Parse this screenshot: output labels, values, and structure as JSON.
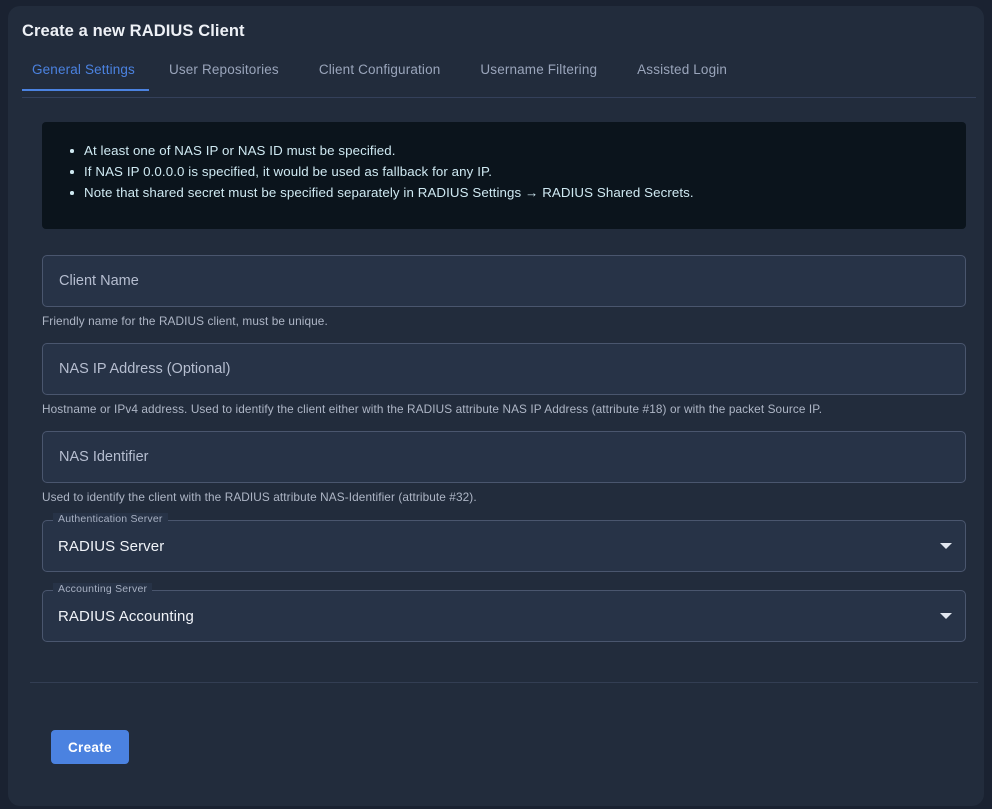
{
  "header": {
    "title": "Create a new RADIUS Client"
  },
  "tabs": {
    "active_index": 0,
    "items": [
      {
        "label": "General Settings"
      },
      {
        "label": "User Repositories"
      },
      {
        "label": "Client Configuration"
      },
      {
        "label": "Username Filtering"
      },
      {
        "label": "Assisted Login"
      }
    ]
  },
  "info_banner": {
    "bullets": [
      "At least one of NAS IP or NAS ID must be specified.",
      "If NAS IP 0.0.0.0 is specified, it would be used as fallback for any IP.",
      "Note that shared secret must be specified separately in RADIUS Settings → RADIUS Shared Secrets."
    ]
  },
  "form": {
    "client_name": {
      "placeholder": "Client Name",
      "value": "",
      "helper": "Friendly name for the RADIUS client, must be unique."
    },
    "nas_ip": {
      "placeholder": "NAS IP Address (Optional)",
      "value": "",
      "helper": "Hostname or IPv4 address. Used to identify the client either with the RADIUS attribute NAS IP Address (attribute #18) or with the packet Source IP."
    },
    "nas_identifier": {
      "placeholder": "NAS Identifier",
      "value": "",
      "helper": "Used to identify the client with the RADIUS attribute NAS-Identifier (attribute #32)."
    },
    "auth_server": {
      "label": "Authentication Server",
      "value": "RADIUS Server"
    },
    "accounting_server": {
      "label": "Accounting Server",
      "value": "RADIUS Accounting"
    }
  },
  "footer": {
    "create_label": "Create"
  },
  "colors": {
    "accent": "#4b82e0",
    "card_bg": "#222c3c",
    "page_bg": "#1a2231",
    "banner_bg": "#0b141c",
    "banner_text": "#cfe9f2",
    "field_bg": "#273347",
    "field_border": "#4a566e",
    "helper_text": "#aeb6c6"
  }
}
